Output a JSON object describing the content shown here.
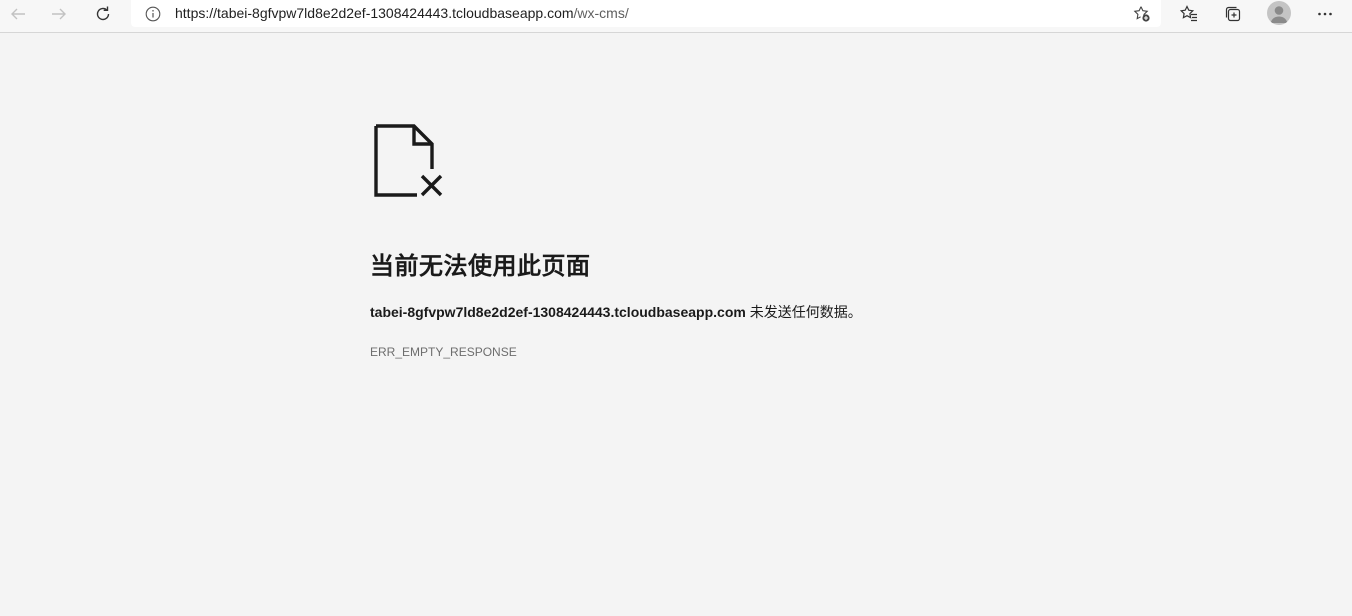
{
  "browser": {
    "url_host": "https://tabei-8gfvpw7ld8e2d2ef-1308424443.tcloudbaseapp.com",
    "url_path": "/wx-cms/",
    "icons": {
      "back": "back-arrow-icon",
      "forward": "forward-arrow-icon",
      "refresh": "refresh-icon",
      "info": "info-icon",
      "add_favorite": "add-favorite-star-icon",
      "favorites": "favorites-icon",
      "collections": "collections-icon",
      "profile": "profile-avatar-icon",
      "menu": "more-menu-icon"
    }
  },
  "error_page": {
    "icon": "broken-document-icon",
    "title": "当前无法使用此页面",
    "host": "tabei-8gfvpw7ld8e2d2ef-1308424443.tcloudbaseapp.com",
    "message": " 未发送任何数据。",
    "code": "ERR_EMPTY_RESPONSE"
  },
  "colors": {
    "page_background": "#f4f4f4",
    "toolbar_background": "#f7f7f7",
    "text_primary": "#1a1a1a",
    "text_secondary": "#6d6d6d"
  }
}
